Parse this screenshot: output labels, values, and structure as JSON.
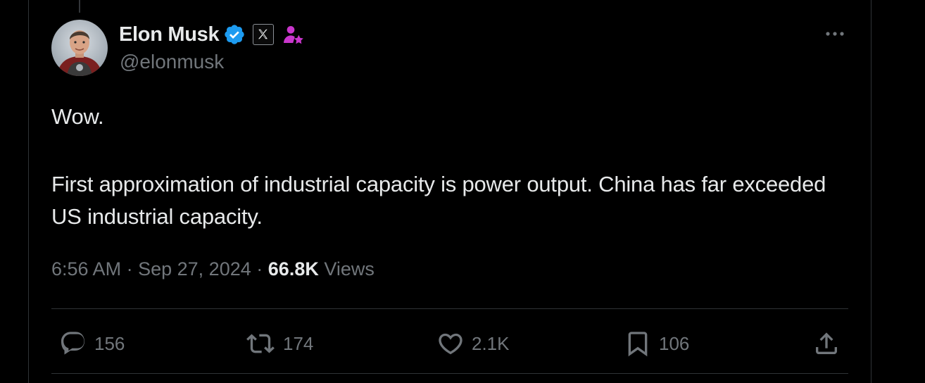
{
  "tweet": {
    "author": {
      "display_name": "Elon Musk",
      "handle": "@elonmusk",
      "verified_color": "#1d9bf0",
      "affiliate_badge_icon": "x-logo-icon",
      "role_badge_icon": "person-star-icon",
      "role_badge_color": "#c936cc"
    },
    "text_paragraphs": [
      "Wow.",
      "First approximation of industrial capacity is power output. China has far exceeded US industrial capacity."
    ],
    "meta": {
      "time": "6:56 AM",
      "separator": "·",
      "date": "Sep 27, 2024",
      "views_count": "66.8K",
      "views_label": "Views"
    },
    "actions": {
      "replies": "156",
      "reposts": "174",
      "likes": "2.1K",
      "bookmarks": "106"
    }
  },
  "colors": {
    "background": "#000000",
    "primary_text": "#e7e9ea",
    "secondary_text": "#71767b",
    "border": "#2f3336",
    "accent": "#1d9bf0"
  }
}
